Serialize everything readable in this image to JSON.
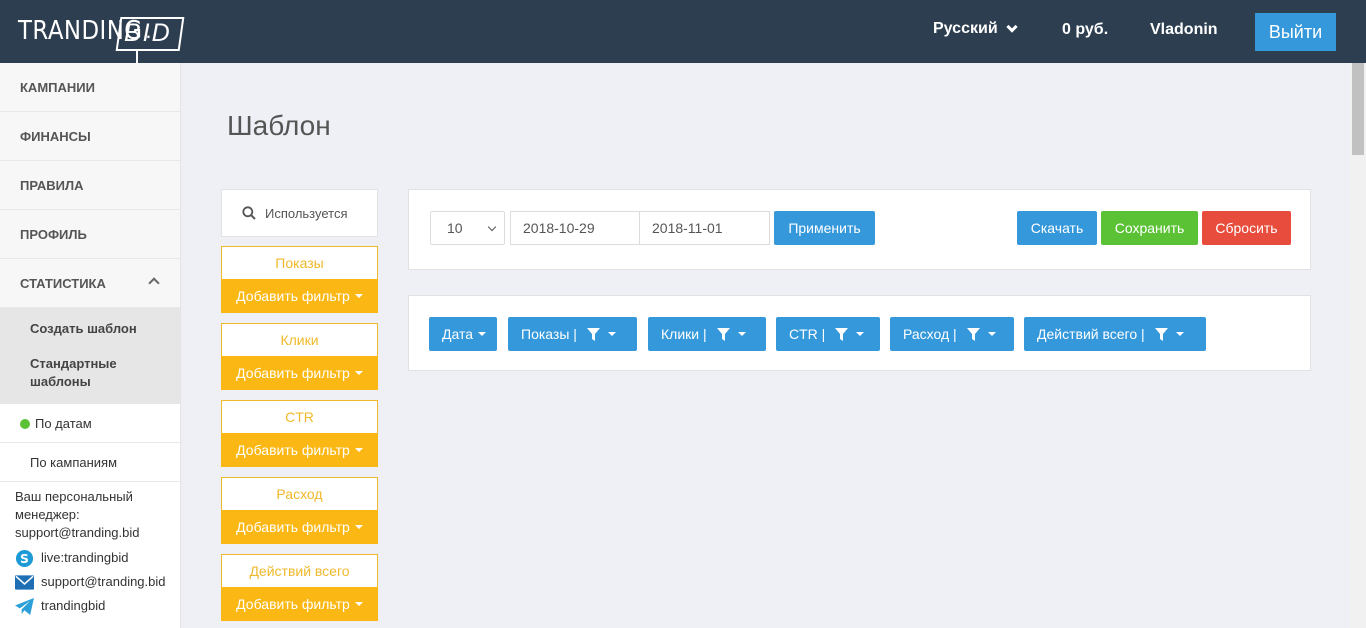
{
  "header": {
    "logo_main": "TRANDING",
    "logo_dot": ".",
    "logo_accent": "BID",
    "language": "Русский",
    "balance": "0 руб.",
    "username": "Vladonin",
    "logout_label": "Выйти"
  },
  "sidebar": {
    "items": [
      {
        "label": "КАМПАНИИ"
      },
      {
        "label": "ФИНАНСЫ"
      },
      {
        "label": "ПРАВИЛА"
      },
      {
        "label": "ПРОФИЛЬ"
      },
      {
        "label": "СТАТИСТИКА"
      }
    ],
    "sub_items": [
      {
        "label": "Создать шаблон"
      },
      {
        "label": "Стандартные шаблоны"
      }
    ],
    "report_items": [
      {
        "label": "По датам"
      },
      {
        "label": "По кампаниям"
      }
    ],
    "support": {
      "manager_label": "Ваш персональный менеджер:",
      "manager_email": "support@tranding.bid",
      "skype": "live:trandingbid",
      "email": "support@tranding.bid",
      "telegram": "trandingbid"
    }
  },
  "main": {
    "title": "Шаблон",
    "search_label": "Используется",
    "filters": [
      {
        "name": "Показы",
        "button": "Добавить фильтр"
      },
      {
        "name": "Клики",
        "button": "Добавить фильтр"
      },
      {
        "name": "CTR",
        "button": "Добавить фильтр"
      },
      {
        "name": "Расход",
        "button": "Добавить фильтр"
      },
      {
        "name": "Действий всего",
        "button": "Добавить фильтр"
      }
    ],
    "toolbar": {
      "page_size": "10",
      "date_from": "2018-10-29",
      "date_to": "2018-11-01",
      "apply_label": "Применить",
      "download_label": "Скачать",
      "save_label": "Сохранить",
      "reset_label": "Сбросить"
    },
    "columns": [
      {
        "label": "Дата"
      },
      {
        "label": "Показы |"
      },
      {
        "label": "Клики |"
      },
      {
        "label": "CTR |"
      },
      {
        "label": "Расход |"
      },
      {
        "label": "Действий всего |"
      }
    ]
  },
  "colors": {
    "header_bg": "#2d3e50",
    "primary": "#3498db",
    "success": "#5bc236",
    "danger": "#e74c3c",
    "warning": "#fbb814"
  },
  "icons": [
    "chevron-down-icon",
    "chevron-up-icon",
    "search-icon",
    "caret-down-icon",
    "filter-icon",
    "skype-icon",
    "mail-icon",
    "telegram-icon",
    "status-dot-icon"
  ]
}
